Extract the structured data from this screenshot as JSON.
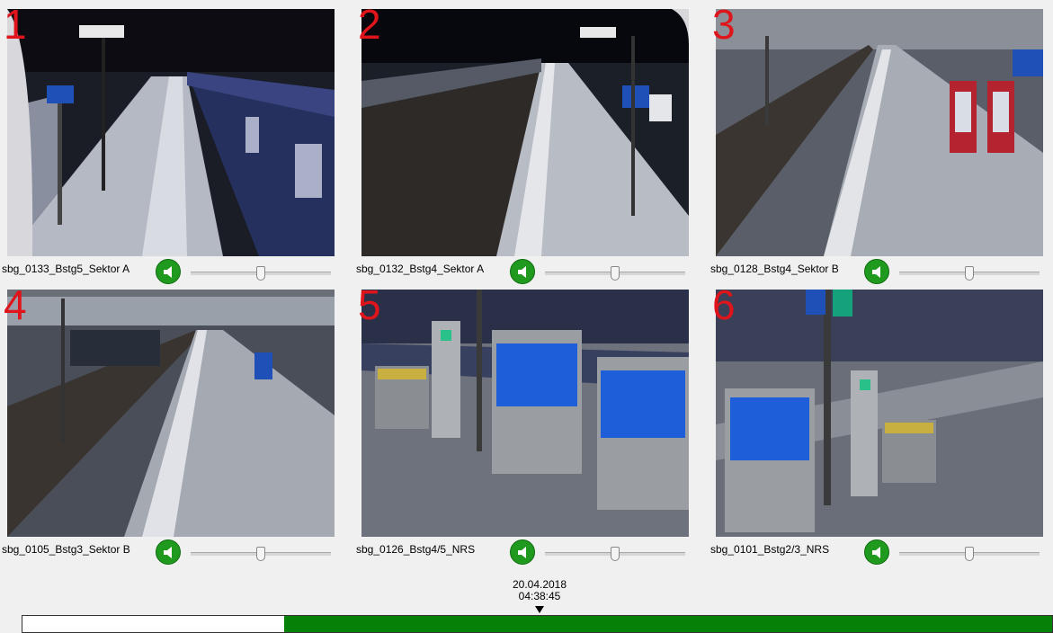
{
  "cameras": [
    {
      "number": "1",
      "label": "sbg_0133_Bstg5_Sektor A",
      "volume": 0.5
    },
    {
      "number": "2",
      "label": "sbg_0132_Bstg4_Sektor A",
      "volume": 0.5
    },
    {
      "number": "3",
      "label": "sbg_0128_Bstg4_Sektor B",
      "volume": 0.5
    },
    {
      "number": "4",
      "label": "sbg_0105_Bstg3_Sektor B",
      "volume": 0.5
    },
    {
      "number": "5",
      "label": "sbg_0126_Bstg4/5_NRS",
      "volume": 0.5
    },
    {
      "number": "6",
      "label": "sbg_0101_Bstg2/3_NRS",
      "volume": 0.5
    }
  ],
  "timeline": {
    "date": "20.04.2018",
    "time": "04:38:45",
    "recorded_fraction": 0.746,
    "recorded_color": "#068006",
    "empty_color": "#ffffff"
  },
  "icons": {
    "speaker": "speaker-icon"
  },
  "colors": {
    "camera_number": "#e0141b",
    "speaker_button": "#1f9a1f"
  }
}
